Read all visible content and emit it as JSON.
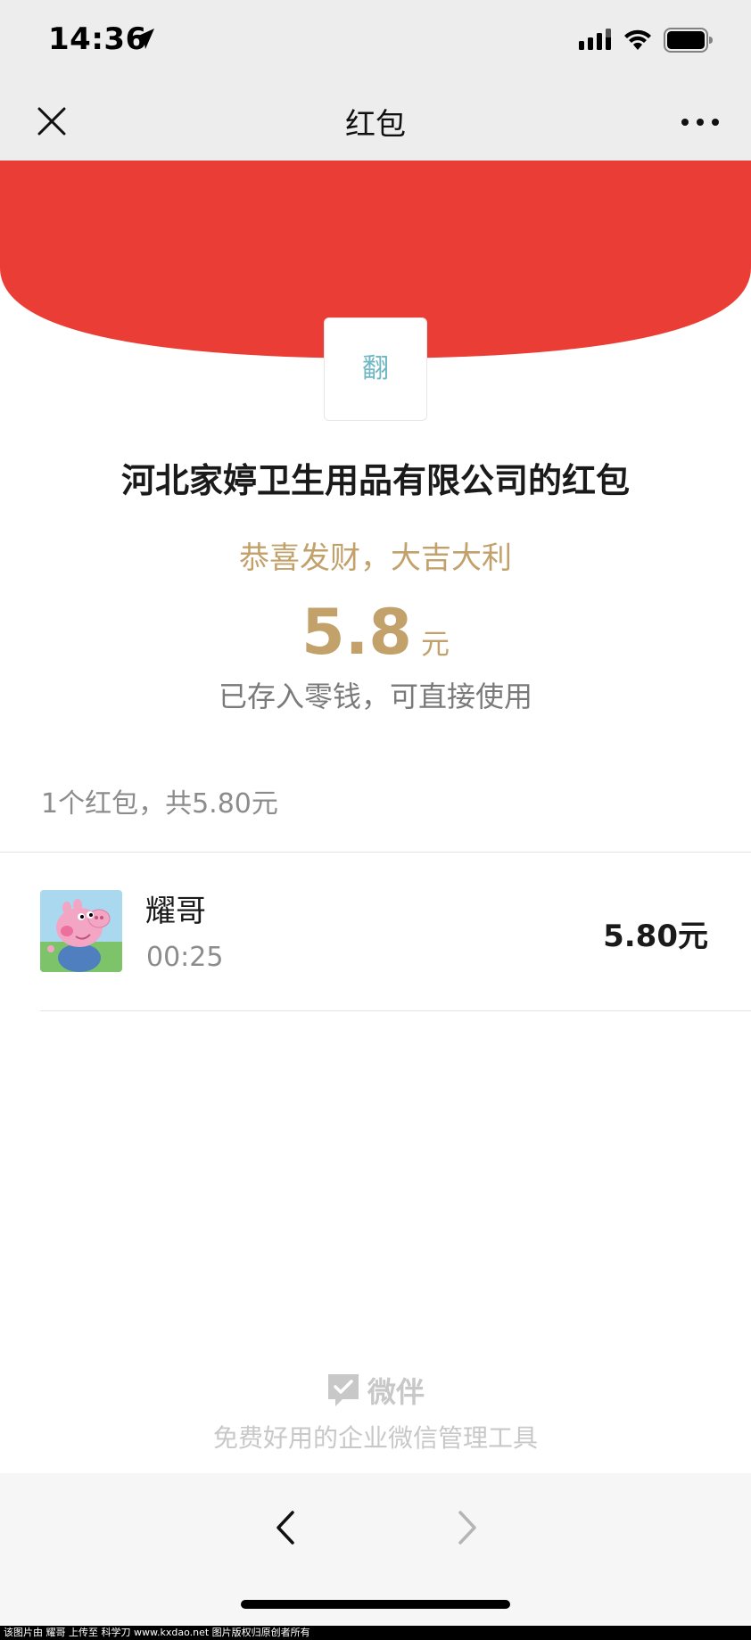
{
  "status_bar": {
    "time": "14:36",
    "icons": [
      "location-arrow-icon",
      "cellular-signal-icon",
      "wifi-icon",
      "battery-icon"
    ]
  },
  "nav": {
    "title": "红包",
    "close_icon": "close-icon",
    "more_icon": "more-icon"
  },
  "envelope": {
    "color": "#EA3D35",
    "sender_logo_text": "翻"
  },
  "detail": {
    "sender_name": "河北家婷卫生用品有限公司的红包",
    "greeting": "恭喜发财，大吉大利",
    "amount": "5.8",
    "amount_unit": "元",
    "deposit_note": "已存入零钱，可直接使用",
    "accent_color": "#C2A16B"
  },
  "summary": {
    "text": "1个红包，共5.80元"
  },
  "records": [
    {
      "name": "耀哥",
      "time": "00:25",
      "amount": "5.80元",
      "avatar": "pig-cartoon-avatar"
    }
  ],
  "footer": {
    "brand_name": "微伴",
    "tagline": "免费好用的企业微信管理工具"
  },
  "bottom_nav": {
    "back_icon": "chevron-left-icon",
    "forward_icon": "chevron-right-icon"
  },
  "watermark": "该图片由 耀哥 上传至 科学刀 www.kxdao.net 图片版权归原创者所有"
}
